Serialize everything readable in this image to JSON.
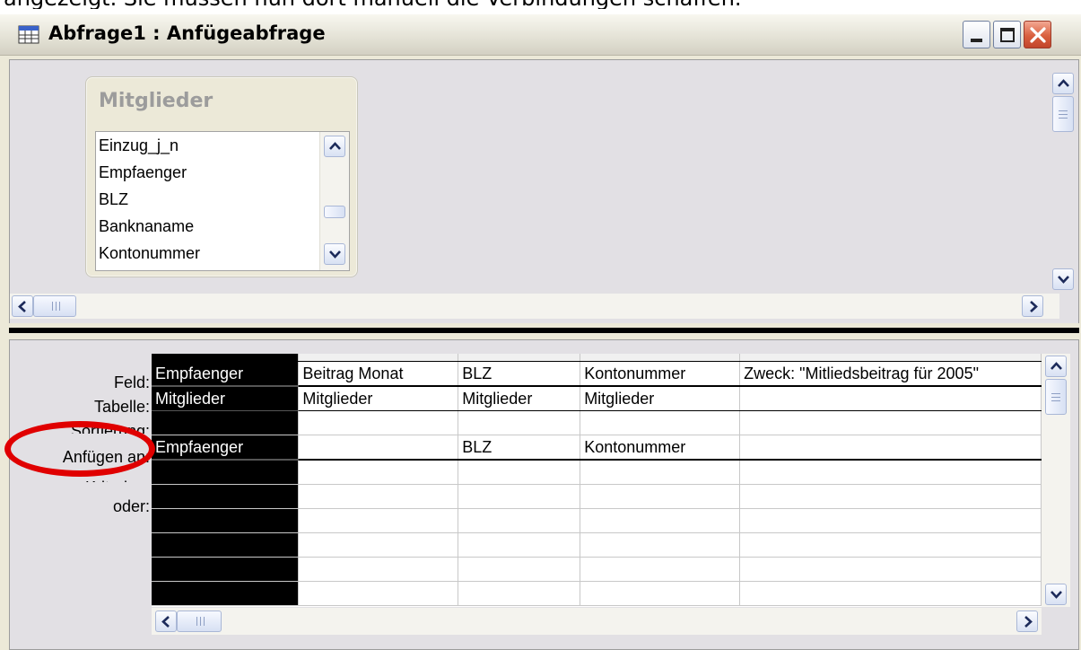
{
  "caption": "angezeigt. Sie müssen nun dort manuell die Verbindungen schaffen.",
  "window": {
    "title": "Abfrage1 : Anfügeabfrage"
  },
  "table_box": {
    "title": "Mitglieder",
    "fields": [
      "Einzug_j_n",
      "Empfaenger",
      "BLZ",
      "Banknaname",
      "Kontonummer"
    ]
  },
  "grid": {
    "row_labels": [
      "Feld:",
      "Tabelle:",
      "Sortierung:",
      "Anfügen an:",
      "Kriterien:",
      "oder:"
    ],
    "columns": [
      {
        "feld": "Empfaenger",
        "tabelle": "Mitglieder",
        "sortierung": "",
        "anfuegen": "Empfaenger",
        "selected": true
      },
      {
        "feld": "Beitrag Monat",
        "tabelle": "Mitglieder",
        "sortierung": "",
        "anfuegen": "",
        "selected": false
      },
      {
        "feld": "BLZ",
        "tabelle": "Mitglieder",
        "sortierung": "",
        "anfuegen": "BLZ",
        "selected": false
      },
      {
        "feld": "Kontonummer",
        "tabelle": "Mitglieder",
        "sortierung": "",
        "anfuegen": "Kontonummer",
        "selected": false
      },
      {
        "feld": "Zweck: \"Mitliedsbeitrag für 2005\"",
        "tabelle": "",
        "sortierung": "",
        "anfuegen": "",
        "selected": false
      }
    ]
  },
  "colors": {
    "highlight": "#e00000",
    "window_bg": "#ece9d8",
    "pane_bg": "#e2e0e4"
  }
}
